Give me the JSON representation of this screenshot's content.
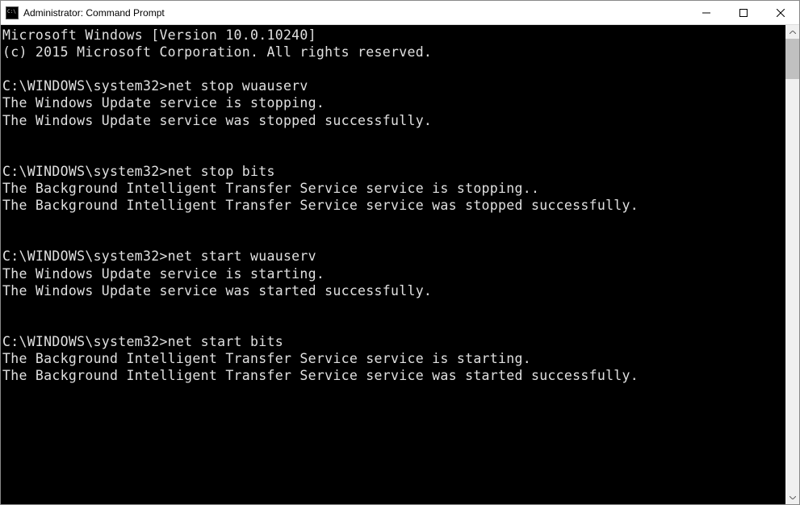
{
  "window": {
    "title": "Administrator: Command Prompt"
  },
  "terminal": {
    "lines": [
      "Microsoft Windows [Version 10.0.10240]",
      "(c) 2015 Microsoft Corporation. All rights reserved.",
      "",
      "C:\\WINDOWS\\system32>net stop wuauserv",
      "The Windows Update service is stopping.",
      "The Windows Update service was stopped successfully.",
      "",
      "",
      "C:\\WINDOWS\\system32>net stop bits",
      "The Background Intelligent Transfer Service service is stopping..",
      "The Background Intelligent Transfer Service service was stopped successfully.",
      "",
      "",
      "C:\\WINDOWS\\system32>net start wuauserv",
      "The Windows Update service is starting.",
      "The Windows Update service was started successfully.",
      "",
      "",
      "C:\\WINDOWS\\system32>net start bits",
      "The Background Intelligent Transfer Service service is starting.",
      "The Background Intelligent Transfer Service service was started successfully.",
      ""
    ]
  }
}
